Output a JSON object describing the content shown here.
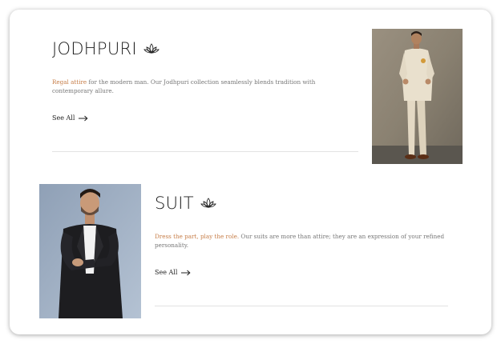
{
  "sections": [
    {
      "title": "JODHPURI",
      "tagline_accent": "Regal attire",
      "tagline_rest": " for the modern man. Our Jodhpuri collection seamlessly blends tradition with contemporary allure.",
      "see_all": "See All"
    },
    {
      "title": "SUIT",
      "tagline_accent": "Dress the part, play the role.",
      "tagline_rest": " Our suits are more than attire; they are an expression of your refined personality.",
      "see_all": "See All"
    }
  ],
  "colors": {
    "accent": "#c77f4a",
    "divider": "#e3e3e3",
    "text": "#1b1b1b"
  },
  "icons": {
    "title_icon": "lotus-icon",
    "see_all_icon": "arrow-right-icon"
  }
}
